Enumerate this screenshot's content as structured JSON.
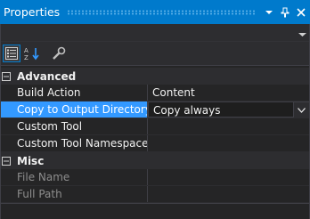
{
  "window": {
    "title": "Properties",
    "accent_color": "#007acc",
    "buttons": [
      "chevron-down-icon",
      "pin-icon",
      "close-icon"
    ]
  },
  "toolbar": {
    "tools": [
      "categorized-icon",
      "alphabetical-icon",
      "property-pages-icon"
    ]
  },
  "grid": {
    "categories": [
      {
        "label": "Advanced",
        "toggle": "⊟",
        "properties": [
          {
            "name": "Build Action",
            "value": "Content"
          },
          {
            "name": "Copy to Output Directory",
            "value": "Copy always"
          },
          {
            "name": "Custom Tool",
            "value": ""
          },
          {
            "name": "Custom Tool Namespace",
            "value": ""
          }
        ]
      },
      {
        "label": "Misc",
        "toggle": "⊟",
        "properties": [
          {
            "name": "File Name",
            "value": ""
          },
          {
            "name": "Full Path",
            "value": ""
          }
        ]
      }
    ],
    "selection_color": "#3399ff"
  }
}
